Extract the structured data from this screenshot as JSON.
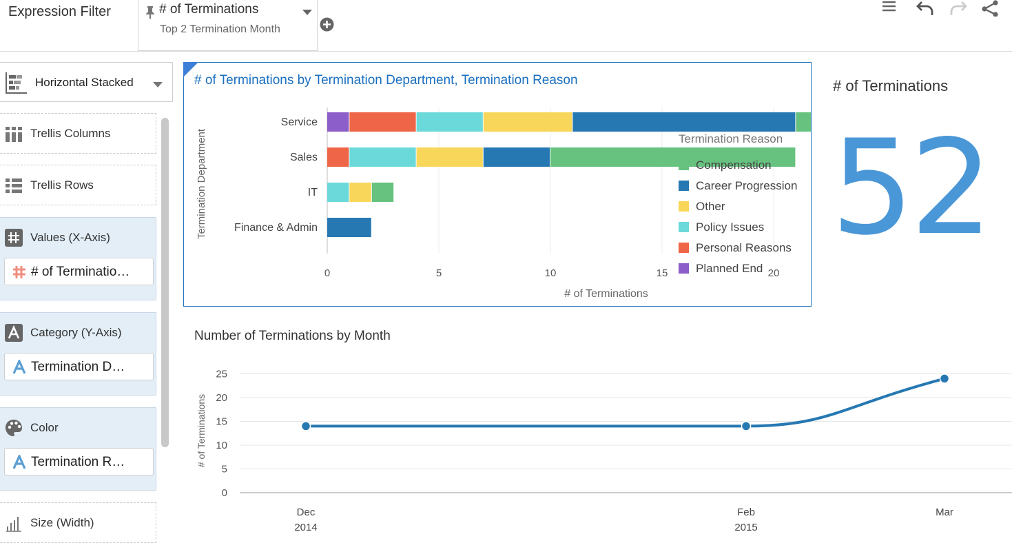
{
  "filter_bar": {
    "label": "Expression Filter",
    "filter_title": "# of Terminations",
    "filter_subtitle": "Top 2 Termination Month"
  },
  "toolbar": {
    "icons": [
      "menu-icon",
      "undo-icon",
      "redo-icon",
      "share-icon"
    ]
  },
  "left_panel": {
    "viz_type": "Horizontal Stacked",
    "drop_targets": {
      "trellis_columns": "Trellis Columns",
      "trellis_rows": "Trellis Rows",
      "values": "Values (X-Axis)",
      "values_item": "# of Terminatio…",
      "category": "Category (Y-Axis)",
      "category_item": "Termination D…",
      "color": "Color",
      "color_item": "Termination R…",
      "size": "Size (Width)"
    }
  },
  "colors": {
    "Compensation": "#66c27e",
    "Career Progression": "#2678b2",
    "Other": "#f8d65a",
    "Policy Issues": "#6bd9d9",
    "Personal Reasons": "#ef6547",
    "Planned End": "#8c5ec9",
    "card_border": "#1e73be",
    "kpi": "#4a97d8",
    "line": "#2678b2"
  },
  "bar_card": {
    "title": "# of Terminations by Termination Department, Termination Reason"
  },
  "kpi": {
    "title": "# of Terminations",
    "value": "52"
  },
  "line_card": {
    "title": "Number of Terminations by Month"
  },
  "chart_data": [
    {
      "type": "bar",
      "orientation": "horizontal",
      "stacked": true,
      "title": "# of Terminations by Termination Department, Termination Reason",
      "xlabel": "# of Terminations",
      "ylabel": "Termination Department",
      "legend_title": "Termination Reason",
      "legend_position": "right",
      "categories": [
        "Service",
        "Sales",
        "IT",
        "Finance & Admin"
      ],
      "xlim": [
        0,
        25
      ],
      "xticks": [
        0,
        5,
        10,
        15,
        20,
        25
      ],
      "series": [
        {
          "name": "Planned End",
          "values": [
            1,
            0,
            0,
            0
          ]
        },
        {
          "name": "Personal Reasons",
          "values": [
            3,
            1,
            0,
            0
          ]
        },
        {
          "name": "Policy Issues",
          "values": [
            3,
            3,
            1,
            0
          ]
        },
        {
          "name": "Other",
          "values": [
            4,
            3,
            1,
            0
          ]
        },
        {
          "name": "Career Progression",
          "values": [
            10,
            3,
            0,
            2
          ]
        },
        {
          "name": "Compensation",
          "values": [
            5,
            11,
            1,
            0
          ]
        }
      ],
      "legend_order": [
        "Compensation",
        "Career Progression",
        "Other",
        "Policy Issues",
        "Personal Reasons",
        "Planned End"
      ]
    },
    {
      "type": "line",
      "title": "Number of Terminations by Month",
      "ylabel": "# of Terminations",
      "ylim": [
        0,
        25
      ],
      "yticks": [
        0,
        5,
        10,
        15,
        20,
        25
      ],
      "x": [
        {
          "month": "Dec",
          "year": "2014"
        },
        {
          "month": "Feb",
          "year": "2015"
        },
        {
          "month": "Mar",
          "year": ""
        }
      ],
      "values": [
        14,
        14,
        24
      ]
    }
  ]
}
